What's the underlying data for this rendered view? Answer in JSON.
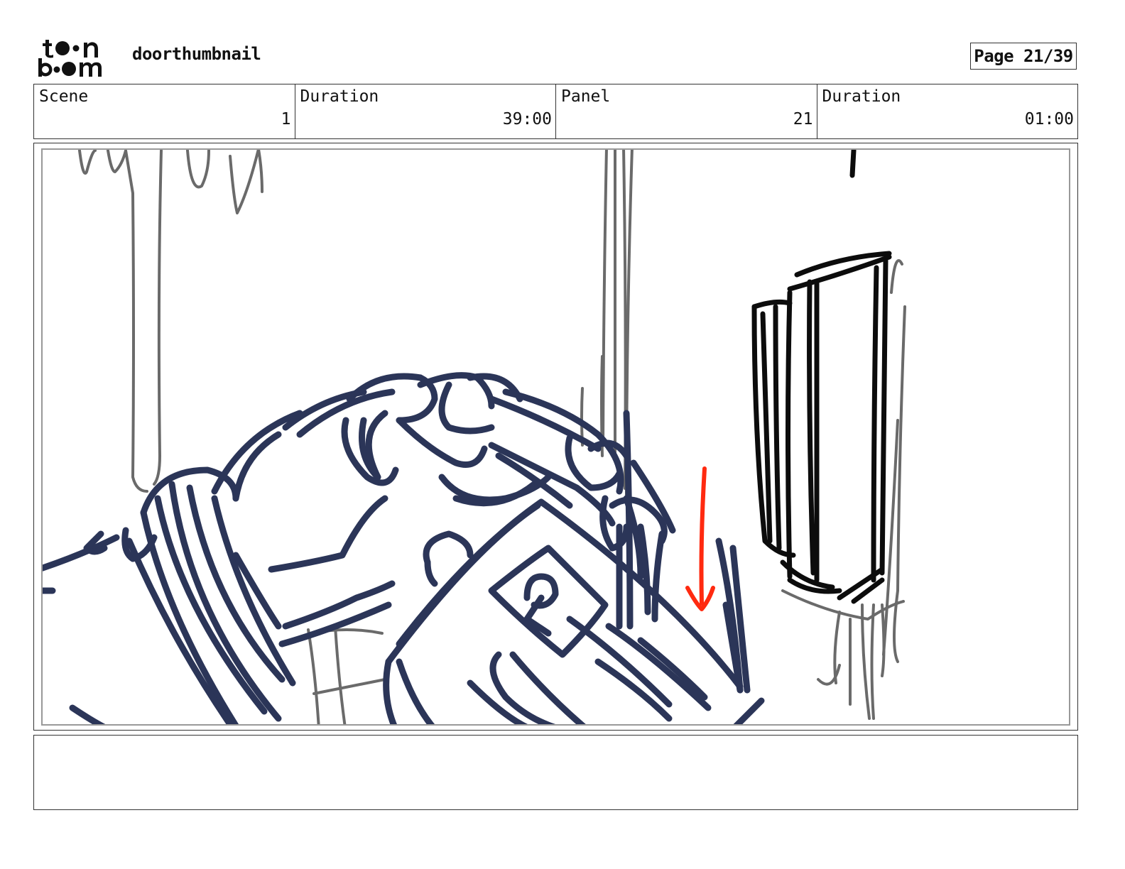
{
  "brand": {
    "logo_icon": "toon-boom-logo-icon"
  },
  "document": {
    "title": "doorthumbnail",
    "page_label": "Page 21/39"
  },
  "info": {
    "scene_label": "Scene",
    "scene_value": "1",
    "scene_duration_label": "Duration",
    "scene_duration_value": "39:00",
    "panel_label": "Panel",
    "panel_value": "21",
    "panel_duration_label": "Duration",
    "panel_duration_value": "01:00"
  },
  "panel": {
    "image_icon": "storyboard-sketch-hand-reaching-door-icon"
  },
  "notes": {
    "text": ""
  },
  "colors": {
    "ink_navy": "#2b3558",
    "ink_gray": "#6a6a6a",
    "ink_black": "#0c0c0c",
    "arrow_red": "#ff2a10"
  }
}
